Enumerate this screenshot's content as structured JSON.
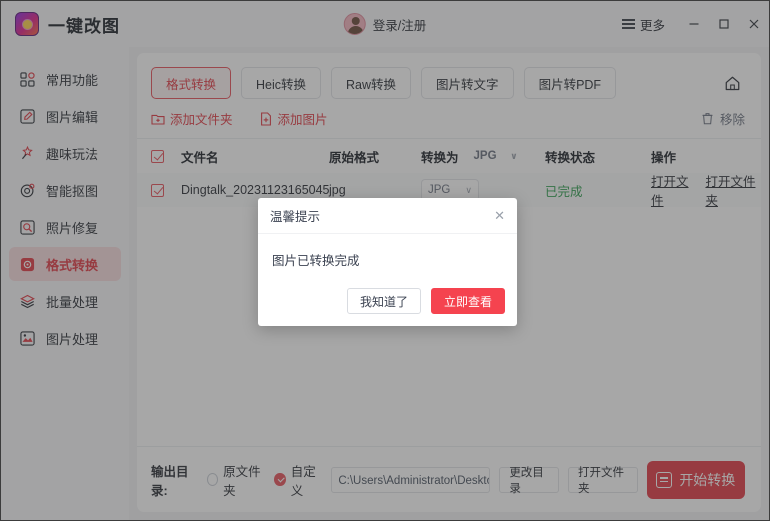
{
  "window": {
    "brand_title": "一键改图",
    "login_label": "登录/注册",
    "more_label": "更多",
    "minimize_label": "最小化",
    "maximize_label": "最大化",
    "close_label": "关闭"
  },
  "sidebar": {
    "items": [
      {
        "label": "常用功能",
        "icon": "grid-icon",
        "active": false
      },
      {
        "label": "图片编辑",
        "icon": "edit-square-icon",
        "active": false
      },
      {
        "label": "趣味玩法",
        "icon": "sparkle-wand-icon",
        "active": false
      },
      {
        "label": "智能抠图",
        "icon": "target-cutout-icon",
        "active": false
      },
      {
        "label": "照片修复",
        "icon": "photo-repair-icon",
        "active": false
      },
      {
        "label": "格式转换",
        "icon": "format-convert-icon",
        "active": true
      },
      {
        "label": "批量处理",
        "icon": "layers-icon",
        "active": false
      },
      {
        "label": "图片处理",
        "icon": "image-process-icon",
        "active": false
      }
    ]
  },
  "tabs": [
    {
      "label": "格式转换",
      "active": true
    },
    {
      "label": "Heic转换",
      "active": false
    },
    {
      "label": "Raw转换",
      "active": false
    },
    {
      "label": "图片转文字",
      "active": false
    },
    {
      "label": "图片转PDF",
      "active": false
    }
  ],
  "toolbar": {
    "add_folder": "添加文件夹",
    "add_image": "添加图片",
    "remove": "移除",
    "home_tooltip": "首页"
  },
  "table": {
    "headers": {
      "filename": "文件名",
      "source_format": "原始格式",
      "convert_to": "转换为",
      "status": "转换状态",
      "operation": "操作"
    },
    "header_format_value": "JPG",
    "rows": [
      {
        "filename": "Dingtalk_20231123165045",
        "source_format": "jpg",
        "convert_to": "JPG",
        "status": "已完成",
        "op_open_file": "打开文件",
        "op_open_folder": "打开文件夹",
        "checked": true
      }
    ]
  },
  "bottom": {
    "output_label": "输出目录:",
    "radio_original": "原文件夹",
    "radio_custom": "自定义",
    "custom_selected": true,
    "path_value": "C:\\Users\\Administrator\\Desktop\\一…",
    "change_dir": "更改目录",
    "open_folder": "打开文件夹",
    "start_button": "开始转换"
  },
  "modal": {
    "title": "温馨提示",
    "message": "图片已转换完成",
    "cancel_label": "我知道了",
    "confirm_label": "立即查看",
    "close_glyph": "✕"
  },
  "colors": {
    "accent_red": "#e23b45",
    "primary_red": "#f5434f",
    "success_green": "#2e9e4f",
    "sidebar_bg": "#f7f8fa"
  }
}
